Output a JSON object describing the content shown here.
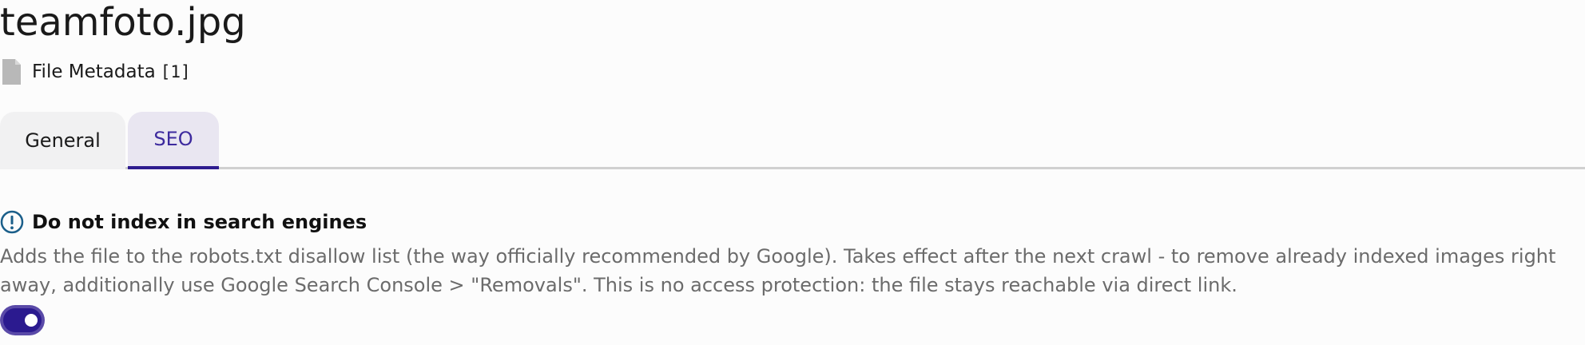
{
  "header": {
    "title": "teamfoto.jpg"
  },
  "record": {
    "icon": "file-icon",
    "label": "File Metadata",
    "count": "[1]"
  },
  "tabs": [
    {
      "label": "General",
      "active": false
    },
    {
      "label": "SEO",
      "active": true
    }
  ],
  "seo": {
    "setting": {
      "icon": "info-circle-icon",
      "title": "Do not index in search engines",
      "description": "Adds the file to the robots.txt disallow list (the way officially recommended by Google). Takes effect after the next crawl - to remove already indexed images right away, additionally use Google Search Console > \"Removals\". This is no access protection: the file stays reachable via direct link.",
      "enabled": true
    }
  },
  "colors": {
    "accent": "#2e1c8f",
    "active_tab_text": "#3d2a9e",
    "info_icon": "#1b5f8a",
    "description_text": "#6b6b6b"
  }
}
